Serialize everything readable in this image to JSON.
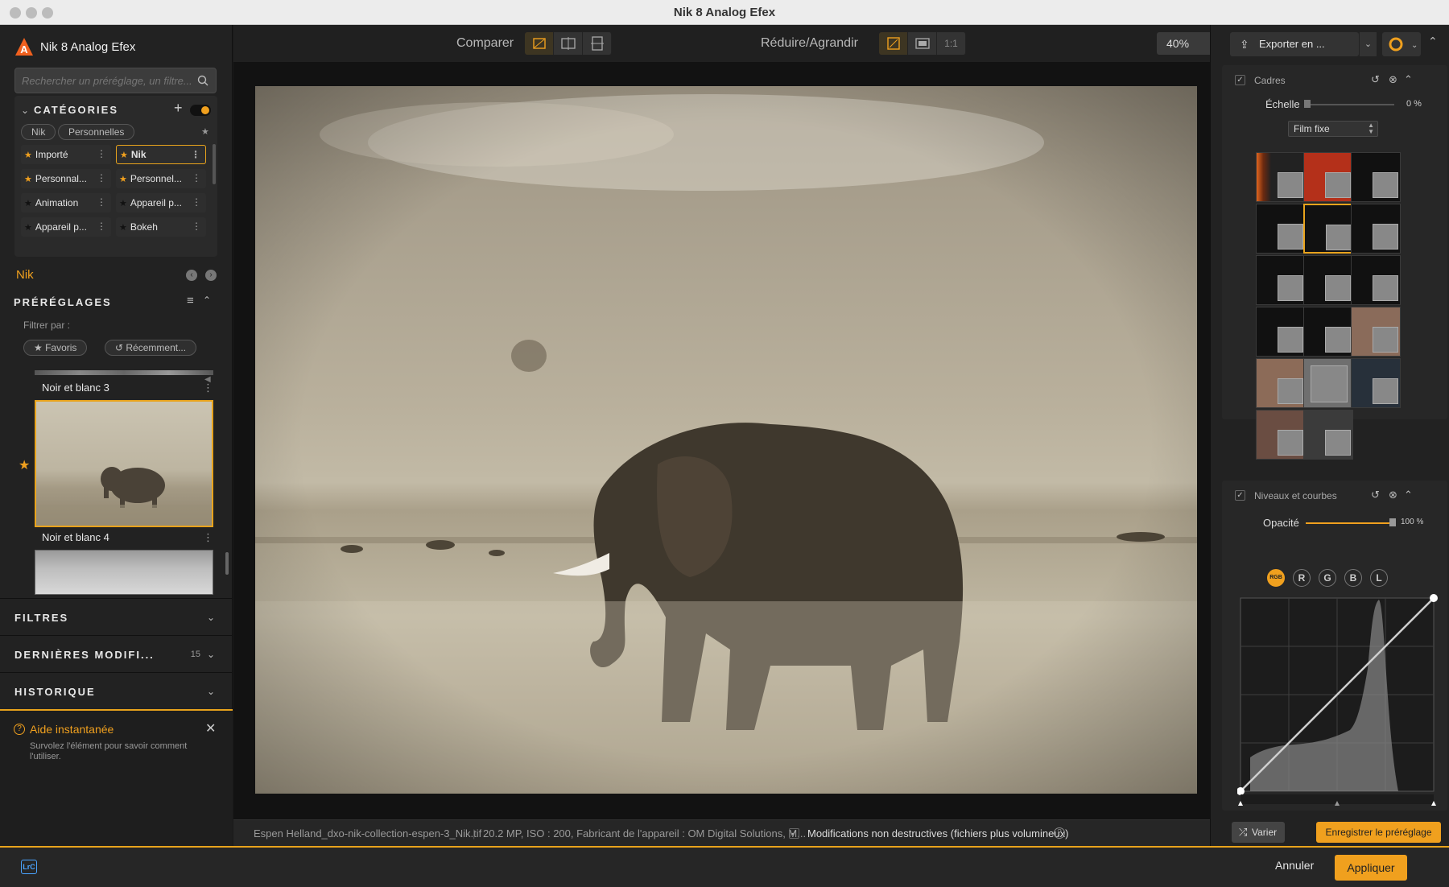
{
  "window": {
    "title": "Nik 8 Analog Efex"
  },
  "app": {
    "name": "Nik 8 Analog Efex"
  },
  "search": {
    "placeholder": "Rechercher un préréglage, un filtre..."
  },
  "categories": {
    "title": "CATÉGORIES",
    "tabs": [
      "Nik",
      "Personnelles"
    ],
    "items": [
      {
        "label": "Importé",
        "starred": true
      },
      {
        "label": "Nik",
        "starred": true,
        "selected": true
      },
      {
        "label": "Personnal...",
        "starred": true
      },
      {
        "label": "Personnel...",
        "starred": true
      },
      {
        "label": "Animation",
        "starred": false
      },
      {
        "label": "Appareil p...",
        "starred": false
      },
      {
        "label": "Appareil p...",
        "starred": false
      },
      {
        "label": "Bokeh",
        "starred": false
      }
    ]
  },
  "current_category": "Nik",
  "presets": {
    "title": "PRÉRÉGLAGES",
    "filter_label": "Filtrer par :",
    "filter_favorites": "Favoris",
    "filter_recent": "Récemment...",
    "items": [
      {
        "label": "Noir et blanc 3"
      },
      {
        "label": "Noir et blanc 4",
        "selected": true,
        "favorite": true
      }
    ]
  },
  "sections": {
    "filters": "FILTRES",
    "recent_edits": "DERNIÈRES MODIFI...",
    "recent_edits_count": "15",
    "history": "HISTORIQUE"
  },
  "help": {
    "title": "Aide instantanée",
    "text": "Survolez l'élément pour savoir comment l'utiliser."
  },
  "toolbar": {
    "compare_label": "Comparer",
    "zoom_label": "Réduire/Agrandir",
    "one_to_one": "1:1",
    "zoom_value": "40%"
  },
  "status": {
    "filename": "Espen Helland_dxo-nik-collection-espen-3_Nik.tif",
    "meta": "20.2 MP, ISO : 200, Fabricant de l'appareil : OM Digital Solutions, M...",
    "nondestructive": "Modifications non destructives (fichiers plus volumineux)"
  },
  "right": {
    "export_label": "Exporter en ...",
    "frames": {
      "title": "Cadres",
      "scale_label": "Échelle",
      "scale_value": "0 %",
      "type_value": "Film fixe",
      "selected_index": 4
    },
    "levels": {
      "title": "Niveaux et courbes",
      "opacity_label": "Opacité",
      "opacity_value": "100 %",
      "channels": [
        "RGB",
        "R",
        "G",
        "B",
        "L"
      ],
      "active_channel": "RGB"
    },
    "vary_label": "Varier",
    "save_preset_label": "Enregistrer le préréglage"
  },
  "bottom": {
    "lrc_label": "LrC",
    "cancel_label": "Annuler",
    "apply_label": "Appliquer"
  },
  "colors": {
    "accent": "#f0a01e",
    "panel": "#222222",
    "canvas": "#121212"
  }
}
